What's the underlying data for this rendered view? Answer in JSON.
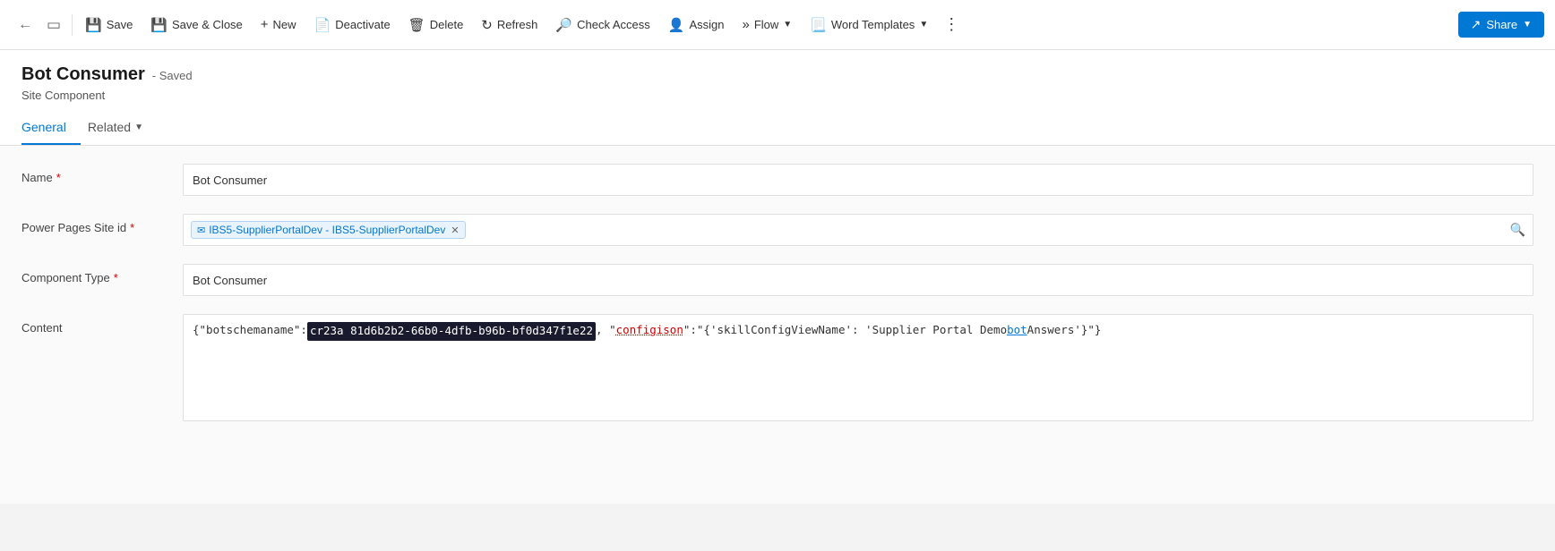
{
  "toolbar": {
    "back_icon": "←",
    "refresh_icon": "↻",
    "save_label": "Save",
    "save_close_label": "Save & Close",
    "new_label": "New",
    "deactivate_label": "Deactivate",
    "delete_label": "Delete",
    "refresh_label": "Refresh",
    "check_access_label": "Check Access",
    "assign_label": "Assign",
    "flow_label": "Flow",
    "word_templates_label": "Word Templates",
    "more_options": "⋮",
    "share_label": "Share"
  },
  "page": {
    "title": "Bot Consumer",
    "status": "- Saved",
    "subtitle": "Site Component",
    "tabs": [
      {
        "id": "general",
        "label": "General",
        "active": true
      },
      {
        "id": "related",
        "label": "Related",
        "active": false,
        "has_arrow": true
      }
    ]
  },
  "form": {
    "fields": [
      {
        "id": "name",
        "label": "Name",
        "required": true,
        "type": "text",
        "value": "Bot Consumer"
      },
      {
        "id": "power_pages_site_id",
        "label": "Power Pages Site id",
        "required": true,
        "type": "lookup",
        "tag_icon": "✉",
        "tag_label": "IBS5-SupplierPortalDev - IBS5-SupplierPortalDev"
      },
      {
        "id": "component_type",
        "label": "Component Type",
        "required": true,
        "type": "text",
        "value": "Bot Consumer"
      },
      {
        "id": "content",
        "label": "Content",
        "required": false,
        "type": "content",
        "prefix": "{\"botschemaname\":",
        "highlighted": "cr23a 81d6b2b2-66b0-4dfb-b96b-bf0d347f1e22",
        "middle": ", \"",
        "link1": "configison",
        "between": "\":\"{'skillConfigViewName': 'Supplier Portal Demo ",
        "link2": "bot",
        "suffix": " Answers'}\"}"
      }
    ]
  }
}
